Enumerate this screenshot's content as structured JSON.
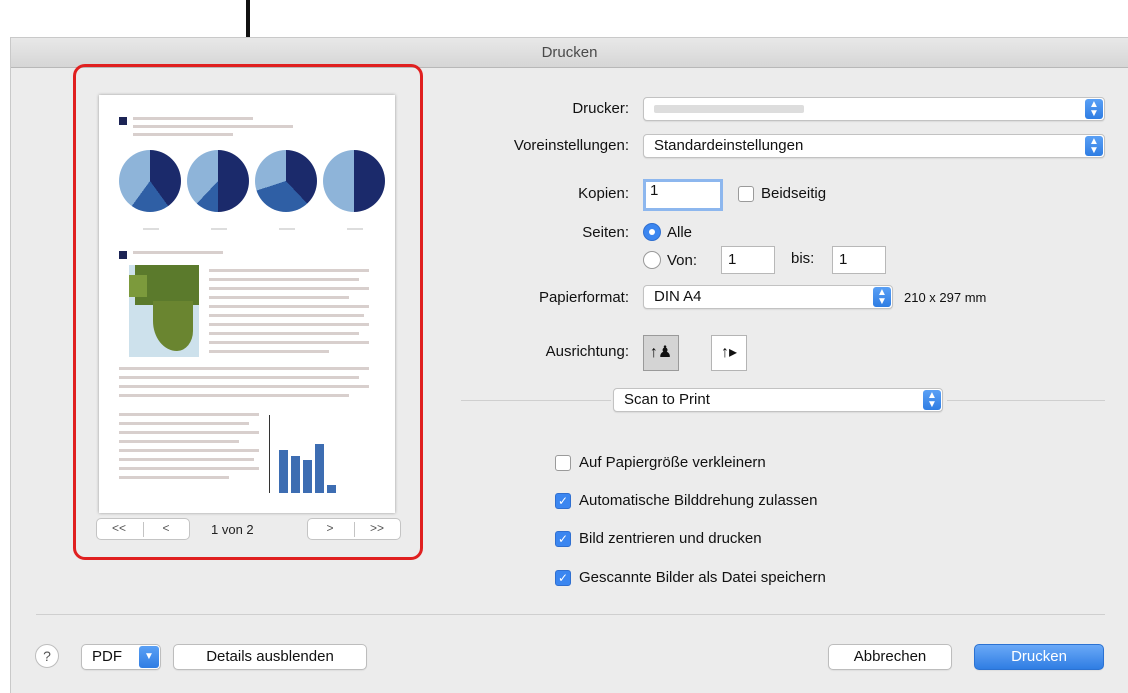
{
  "dialog": {
    "title": "Drucken"
  },
  "preview": {
    "page_indicator": "1 von 2",
    "nav": {
      "first": "<<",
      "prev": "<",
      "next": ">",
      "last": ">>"
    },
    "pie_colors": {
      "dark": "#1b2a6b",
      "mid": "#2f5fa5",
      "light": "#8eb4d9"
    },
    "bar_color": "#3d6db2",
    "bar_values": [
      0.55,
      0.47,
      0.42,
      0.63,
      0.1
    ]
  },
  "form": {
    "printer": {
      "label": "Drucker:",
      "value": ""
    },
    "presets": {
      "label": "Voreinstellungen:",
      "value": "Standardeinstellungen"
    },
    "copies": {
      "label": "Kopien:",
      "value": "1",
      "duplex_label": "Beidseitig",
      "duplex_checked": false
    },
    "pages": {
      "label": "Seiten:",
      "all_label": "Alle",
      "from_label": "Von:",
      "from_value": "1",
      "to_label": "bis:",
      "to_value": "1",
      "selected": "all"
    },
    "paper": {
      "label": "Papierformat:",
      "value": "DIN A4",
      "size": "210 x 297 mm"
    },
    "orientation": {
      "label": "Ausrichtung:",
      "selected": "portrait",
      "portrait_icon": "portrait-orientation-icon",
      "landscape_icon": "landscape-orientation-icon"
    },
    "section": {
      "value": "Scan to Print"
    },
    "options": [
      {
        "label": "Auf Papiergröße verkleinern",
        "checked": false
      },
      {
        "label": "Automatische Bilddrehung zulassen",
        "checked": true
      },
      {
        "label": "Bild zentrieren und drucken",
        "checked": true
      },
      {
        "label": "Gescannte Bilder als Datei speichern",
        "checked": true
      }
    ]
  },
  "footer": {
    "help": "?",
    "pdf": "PDF",
    "details": "Details ausblenden",
    "cancel": "Abbrechen",
    "print": "Drucken"
  },
  "colors": {
    "accent": "#3b86f0",
    "highlight": "#e02020"
  }
}
